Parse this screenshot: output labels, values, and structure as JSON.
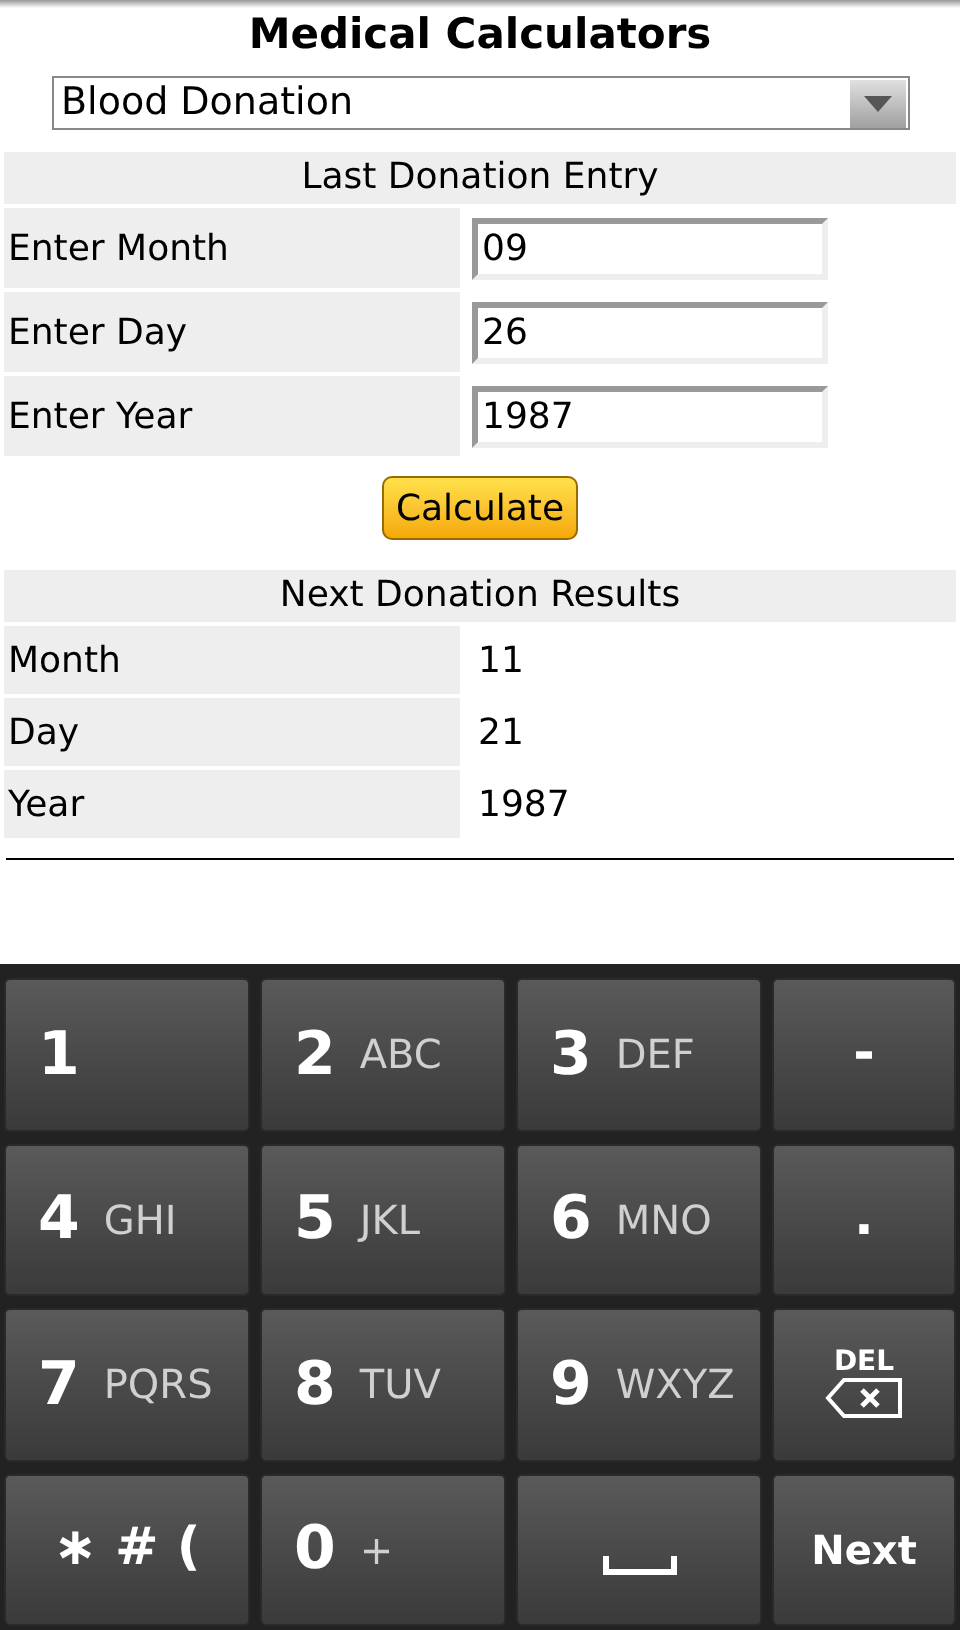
{
  "title": "Medical Calculators",
  "calculator_select": {
    "value": "Blood Donation"
  },
  "entry_section": {
    "heading": "Last Donation Entry",
    "fields": [
      {
        "label": "Enter Month",
        "value": "09"
      },
      {
        "label": "Enter Day",
        "value": "26"
      },
      {
        "label": "Enter Year",
        "value": "1987"
      }
    ]
  },
  "calculate_button": "Calculate",
  "results_section": {
    "heading": "Next Donation Results",
    "rows": [
      {
        "label": "Month",
        "value": "11"
      },
      {
        "label": "Day",
        "value": "21"
      },
      {
        "label": "Year",
        "value": "1987"
      }
    ]
  },
  "keyboard": {
    "rows": [
      [
        {
          "kind": "digit",
          "main": "1"
        },
        {
          "kind": "digit",
          "main": "2",
          "sub": "ABC"
        },
        {
          "kind": "digit",
          "main": "3",
          "sub": "DEF"
        },
        {
          "kind": "symbol",
          "main": "-"
        }
      ],
      [
        {
          "kind": "digit",
          "main": "4",
          "sub": "GHI"
        },
        {
          "kind": "digit",
          "main": "5",
          "sub": "JKL"
        },
        {
          "kind": "digit",
          "main": "6",
          "sub": "MNO"
        },
        {
          "kind": "symbol",
          "main": "."
        }
      ],
      [
        {
          "kind": "digit",
          "main": "7",
          "sub": "PQRS"
        },
        {
          "kind": "digit",
          "main": "8",
          "sub": "TUV"
        },
        {
          "kind": "digit",
          "main": "9",
          "sub": "WXYZ"
        },
        {
          "kind": "delete",
          "main": "DEL"
        }
      ],
      [
        {
          "kind": "symbol",
          "main": "∗ # ("
        },
        {
          "kind": "digit",
          "main": "0",
          "sub": "+"
        },
        {
          "kind": "space"
        },
        {
          "kind": "action",
          "main": "Next"
        }
      ]
    ]
  }
}
